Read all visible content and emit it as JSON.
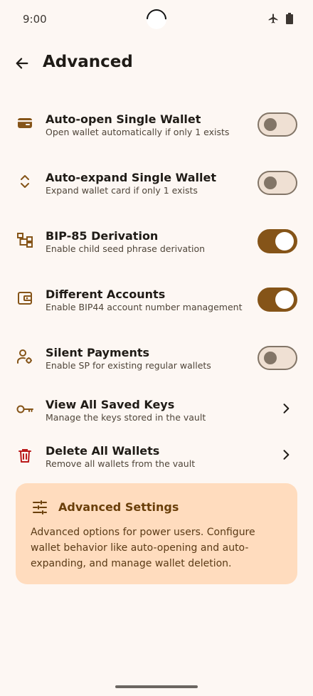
{
  "status_bar": {
    "time": "9:00"
  },
  "header": {
    "title": "Advanced"
  },
  "settings": [
    {
      "title": "Auto-open Single Wallet",
      "subtitle": "Open wallet automatically if only 1 exists",
      "icon": "wallet-icon",
      "enabled": false
    },
    {
      "title": "Auto-expand Single Wallet",
      "subtitle": "Expand wallet card if only 1 exists",
      "icon": "expand-icon",
      "enabled": false
    },
    {
      "title": "BIP-85 Derivation",
      "subtitle": "Enable child seed phrase derivation",
      "icon": "tree-icon",
      "enabled": true
    },
    {
      "title": "Different Accounts",
      "subtitle": "Enable BIP44 account number management",
      "icon": "account-wallet-icon",
      "enabled": true
    },
    {
      "title": "Silent Payments",
      "subtitle": "Enable SP for existing regular wallets",
      "icon": "user-settings-icon",
      "enabled": false
    }
  ],
  "nav_items": [
    {
      "title": "View All Saved Keys",
      "subtitle": "Manage the keys stored in the vault",
      "icon": "key-icon"
    },
    {
      "title": "Delete All Wallets",
      "subtitle": "Remove all wallets from the vault",
      "icon": "trash-icon"
    }
  ],
  "info_card": {
    "title": "Advanced Settings",
    "body": "Advanced options for power users. Configure wallet behavior like auto-opening and auto-expanding, and manage wallet deletion."
  },
  "colors": {
    "accent": "#855418",
    "background": "#fdf7f3",
    "card": "#ffdcbe",
    "danger": "#ba1a1a"
  }
}
